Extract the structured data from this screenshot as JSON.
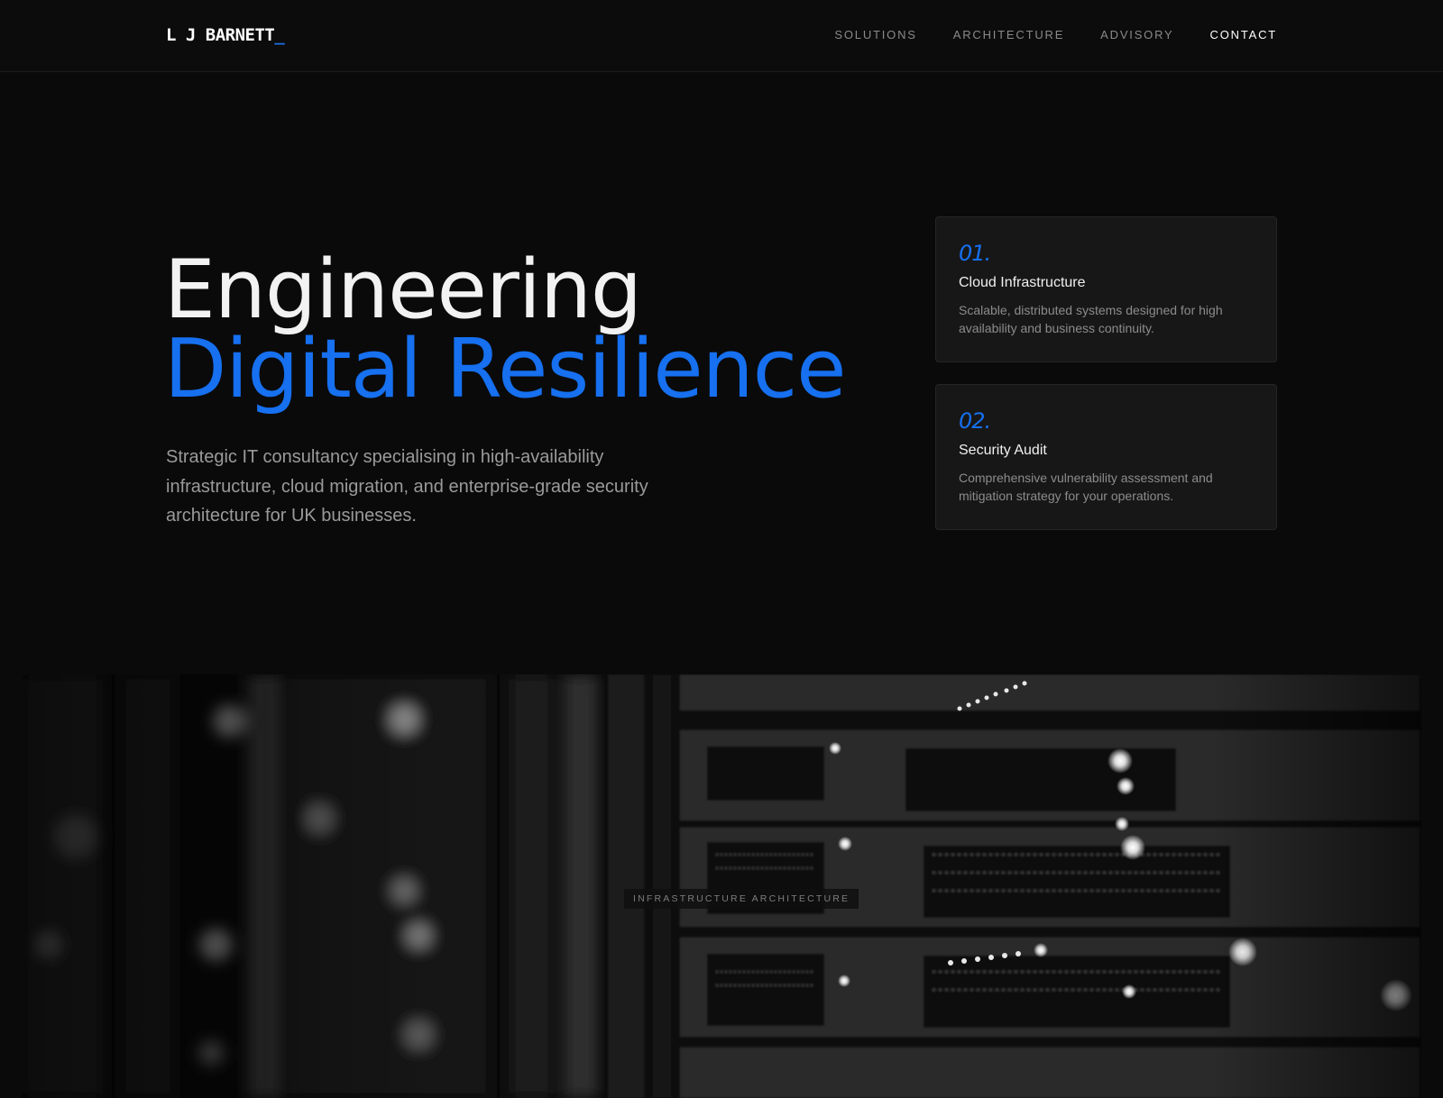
{
  "brand": {
    "name": "L J BARNETT",
    "cursor": "_"
  },
  "nav": {
    "items": [
      {
        "label": "SOLUTIONS"
      },
      {
        "label": "ARCHITECTURE"
      },
      {
        "label": "ADVISORY"
      },
      {
        "label": "CONTACT"
      }
    ]
  },
  "hero": {
    "title_line1": "Engineering",
    "title_line2": "Digital Resilience",
    "subtitle": "Strategic IT consultancy specialising in high-availability infrastructure, cloud migration, and enterprise-grade security architecture for UK businesses."
  },
  "services": [
    {
      "number": "01.",
      "title": "Cloud Infrastructure",
      "description": "Scalable, distributed systems designed for high availability and business continuity."
    },
    {
      "number": "02.",
      "title": "Security Audit",
      "description": "Comprehensive vulnerability assessment and mitigation strategy for your operations."
    }
  ],
  "visual": {
    "caption": "INFRASTRUCTURE ARCHITECTURE"
  },
  "colors": {
    "accent": "#1670f0",
    "background": "#0a0a0a",
    "card": "#171717"
  }
}
